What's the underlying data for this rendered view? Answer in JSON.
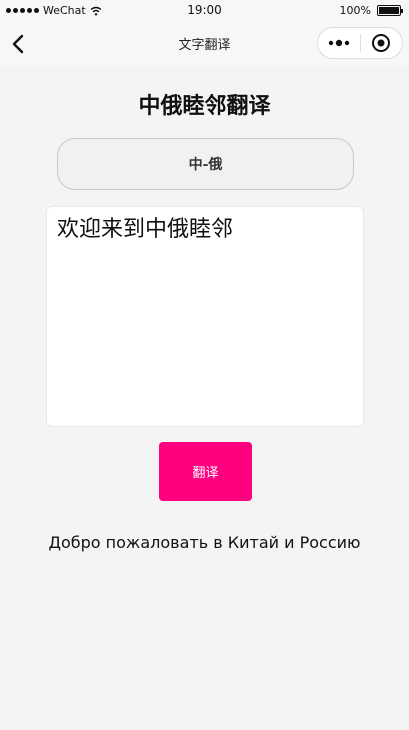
{
  "status_bar": {
    "carrier": "WeChat",
    "time": "19:00",
    "battery": "100%",
    "battery_level": 1.0
  },
  "nav_bar": {
    "title": "文字翻译",
    "back_icon": "chevron-left-icon",
    "more_icon": "more-dots-icon",
    "close_icon": "target-circle-icon"
  },
  "page": {
    "title": "中俄睦邻翻译",
    "language_pair": "中-俄",
    "input_text": "欢迎来到中俄睦邻",
    "translate_label": "翻译",
    "result_text": "Добро пожаловать в Китай и Россию"
  },
  "colors": {
    "accent": "#ff007f",
    "background": "#f4f4f4",
    "bar_background": "#f7f7f7"
  }
}
